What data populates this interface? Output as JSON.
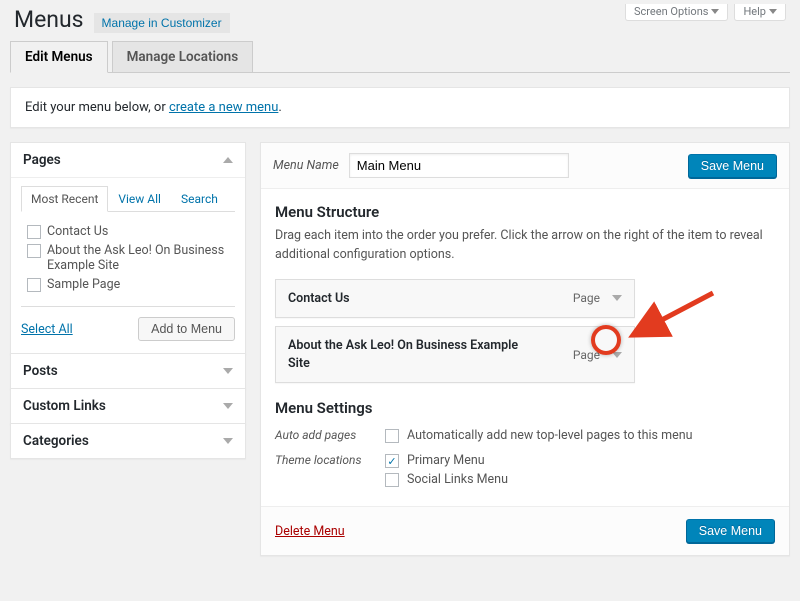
{
  "top_tabs": {
    "screen_options": "Screen Options",
    "help": "Help"
  },
  "page_title": "Menus",
  "manage_customizer": "Manage in Customizer",
  "nav_tabs": {
    "edit": "Edit Menus",
    "locations": "Manage Locations"
  },
  "intro": {
    "prefix": "Edit your menu below, or ",
    "link": "create a new menu",
    "suffix": "."
  },
  "metaboxes": {
    "pages": {
      "title": "Pages",
      "tabs": {
        "recent": "Most Recent",
        "viewall": "View All",
        "search": "Search"
      },
      "items": [
        "Contact Us",
        "About the Ask Leo! On Business Example Site",
        "Sample Page"
      ],
      "select_all": "Select All",
      "add_to_menu": "Add to Menu"
    },
    "posts": "Posts",
    "custom_links": "Custom Links",
    "categories": "Categories"
  },
  "menu_edit": {
    "menu_name_label": "Menu Name",
    "menu_name_value": "Main Menu",
    "save_menu": "Save Menu",
    "structure_title": "Menu Structure",
    "structure_help": "Drag each item into the order you prefer. Click the arrow on the right of the item to reveal additional configuration options.",
    "items": [
      {
        "title": "Contact Us",
        "type": "Page"
      },
      {
        "title": "About the Ask Leo! On Business Example Site",
        "type": "Page"
      }
    ],
    "settings_title": "Menu Settings",
    "auto_add_label": "Auto add pages",
    "auto_add_opt": "Automatically add new top-level pages to this menu",
    "theme_loc_label": "Theme locations",
    "theme_loc_opts": [
      {
        "label": "Primary Menu",
        "checked": true
      },
      {
        "label": "Social Links Menu",
        "checked": false
      }
    ],
    "delete_menu": "Delete Menu"
  }
}
